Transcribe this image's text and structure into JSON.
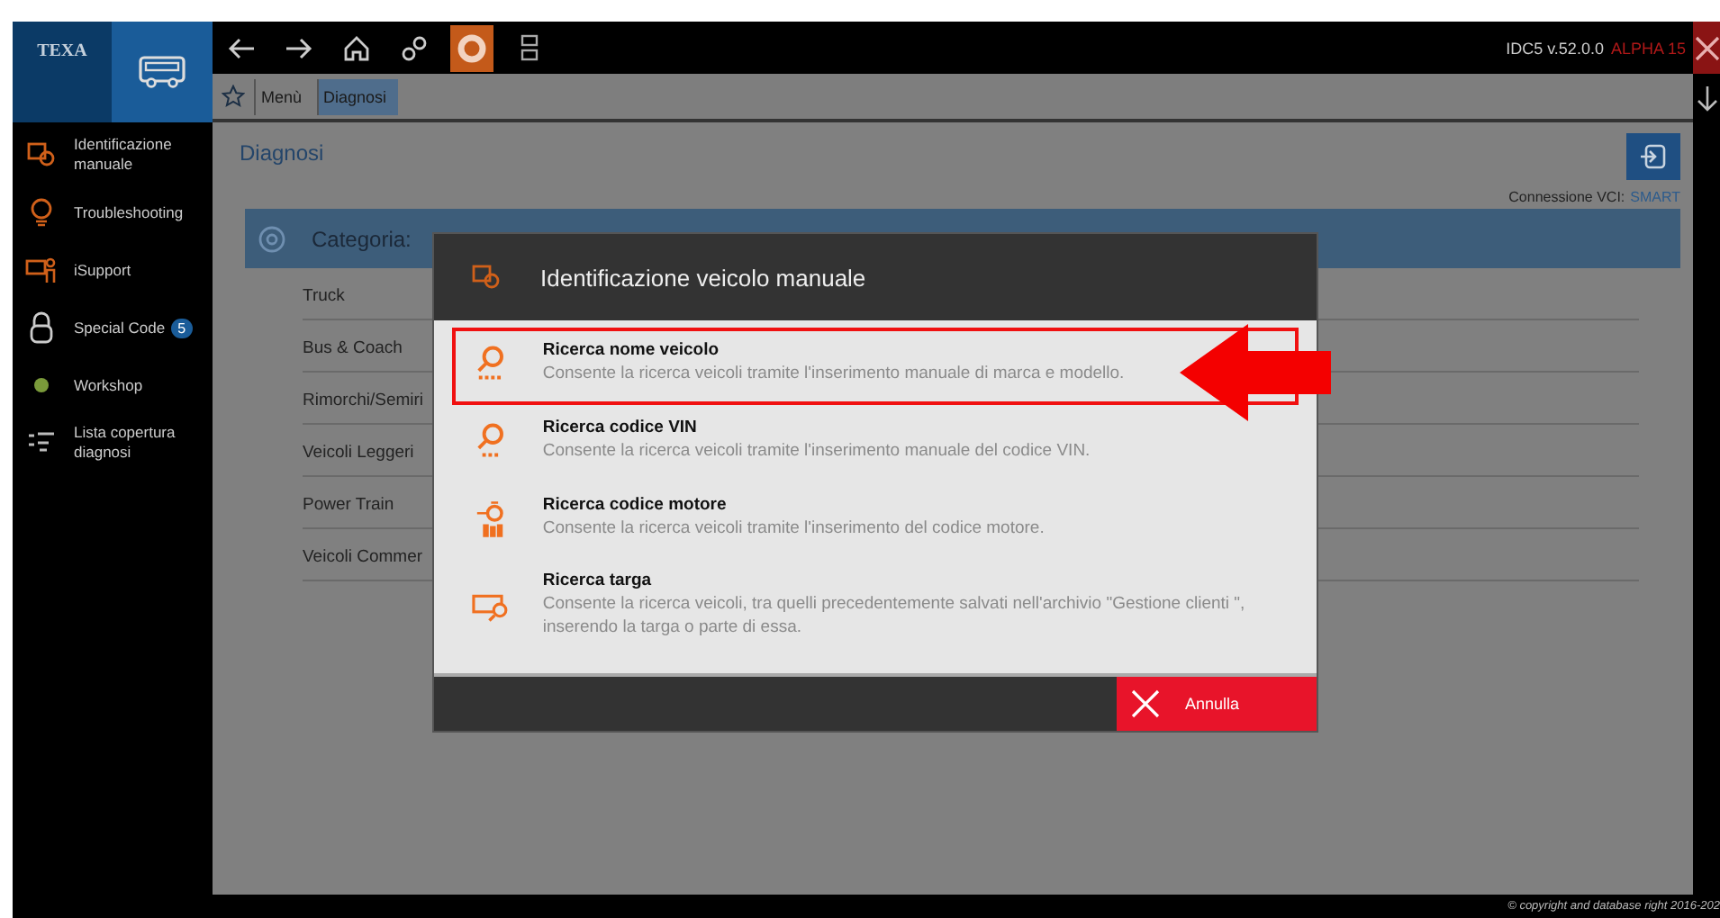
{
  "logo": {
    "text": "TEXA"
  },
  "version": {
    "text": "IDC5 v.52.0.0",
    "tag": "ALPHA 15"
  },
  "toolbar": [
    {
      "kind": "back",
      "active": false
    },
    {
      "kind": "forward",
      "active": false
    },
    {
      "kind": "home",
      "active": false
    },
    {
      "kind": "gears",
      "active": false
    },
    {
      "kind": "lifebuoy",
      "active": true
    },
    {
      "kind": "vehicles",
      "active": false
    }
  ],
  "breadcrumb": [
    {
      "label": "Menù",
      "selected": false
    },
    {
      "label": "Diagnosi",
      "selected": true
    }
  ],
  "sidebar": {
    "items": [
      {
        "label": "Identificazione manuale"
      },
      {
        "label": "Troubleshooting"
      },
      {
        "label": "iSupport"
      },
      {
        "label": "Special Code",
        "badge": "5"
      },
      {
        "label": "Workshop"
      },
      {
        "label": "Lista copertura diagnosi"
      }
    ]
  },
  "page": {
    "title": "Diagnosi",
    "vci_label": "Connessione VCI:",
    "vci_value": "SMART"
  },
  "category": {
    "title": "Categoria:",
    "items": [
      "Truck",
      "Bus & Coach",
      "Rimorchi/Semiri",
      "Veicoli Leggeri",
      "Power Train",
      "Veicoli Commer"
    ]
  },
  "dialog": {
    "title": "Identificazione veicolo manuale",
    "options": [
      {
        "title": "Ricerca nome veicolo",
        "description": "Consente la ricerca veicoli tramite l'inserimento manuale di marca e modello.",
        "highlighted": true
      },
      {
        "title": "Ricerca codice VIN",
        "description": "Consente la ricerca veicoli tramite l'inserimento manuale del codice VIN.",
        "highlighted": false
      },
      {
        "title": "Ricerca codice motore",
        "description": "Consente la ricerca veicoli tramite l'inserimento del codice motore.",
        "highlighted": false
      },
      {
        "title": "Ricerca targa",
        "description": "Consente la ricerca veicoli, tra quelli precedentemente salvati nell'archivio \"Gestione clienti \", inserendo la targa o parte di essa.",
        "highlighted": false
      }
    ],
    "cancel": "Annulla"
  },
  "copyright": "© copyright and database right 2016-202"
}
